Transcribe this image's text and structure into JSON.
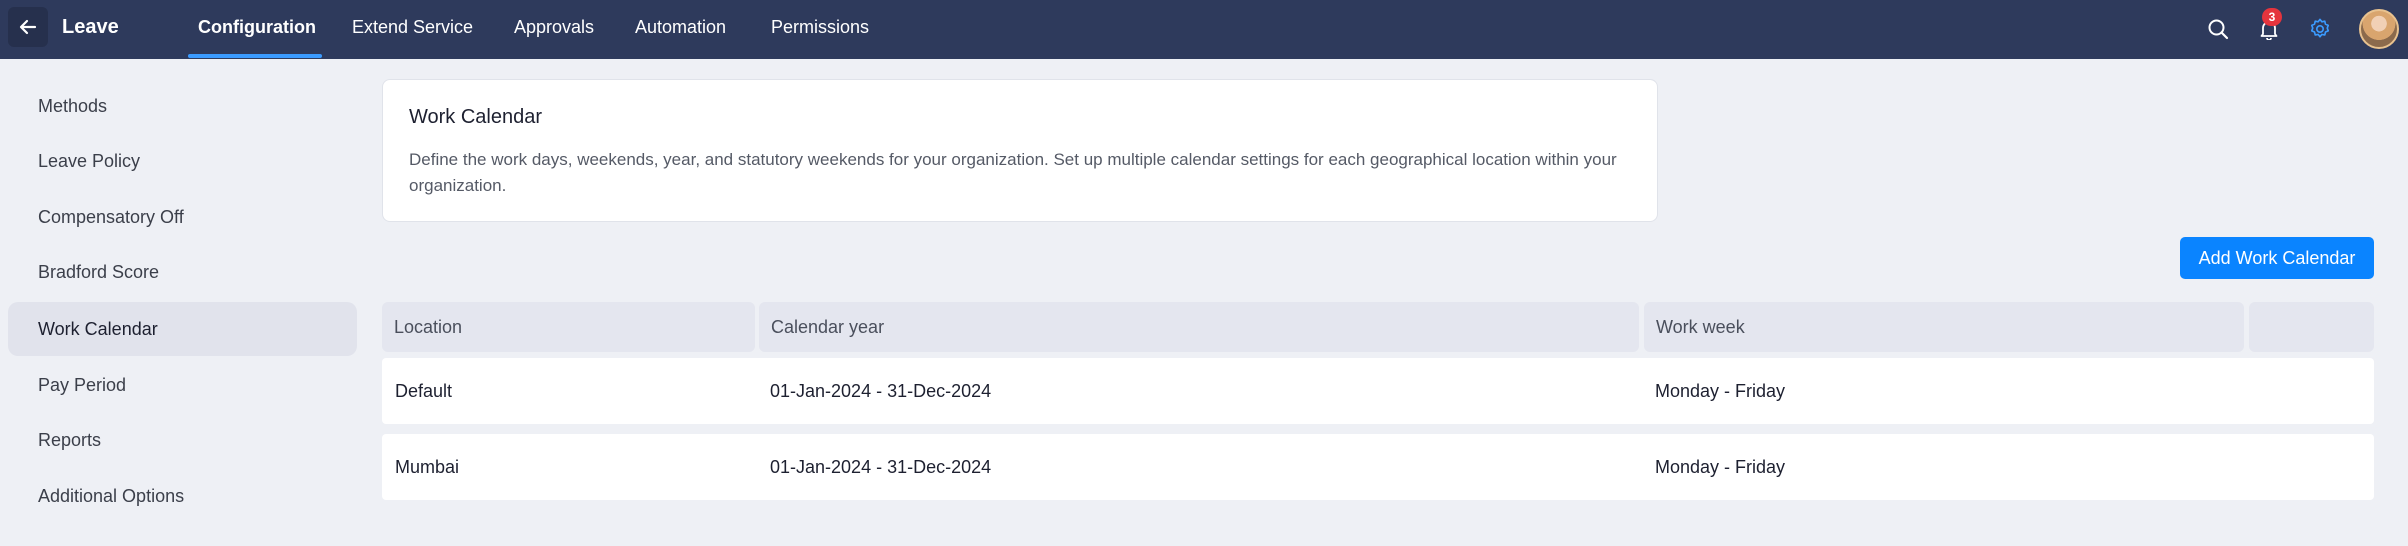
{
  "header": {
    "app_title": "Leave",
    "tabs": [
      {
        "label": "Configuration",
        "active": true
      },
      {
        "label": "Extend Service"
      },
      {
        "label": "Approvals"
      },
      {
        "label": "Automation"
      },
      {
        "label": "Permissions"
      }
    ],
    "notification_count": "3",
    "icons": [
      "back-arrow-icon",
      "search-icon",
      "bell-icon",
      "gear-icon"
    ],
    "accent_color": "#3b9bff"
  },
  "sidebar": {
    "items": [
      {
        "label": "Methods"
      },
      {
        "label": "Leave Policy"
      },
      {
        "label": "Compensatory Off"
      },
      {
        "label": "Bradford Score"
      },
      {
        "label": "Work Calendar",
        "active": true
      },
      {
        "label": "Pay Period"
      },
      {
        "label": "Reports"
      },
      {
        "label": "Additional Options"
      }
    ]
  },
  "main": {
    "card": {
      "title": "Work Calendar",
      "description": "Define the work days, weekends, year, and statutory weekends for your organization. Set up multiple calendar settings for each geographical location within your organization."
    },
    "add_button_label": "Add Work Calendar",
    "add_button_color": "#0a84ff",
    "table": {
      "headers": [
        "Location",
        "Calendar year",
        "Work week",
        ""
      ],
      "rows": [
        {
          "location": "Default",
          "calendar_year": "01-Jan-2024 - 31-Dec-2024",
          "work_week": "Monday - Friday"
        },
        {
          "location": "Mumbai",
          "calendar_year": "01-Jan-2024 - 31-Dec-2024",
          "work_week": "Monday - Friday"
        }
      ]
    }
  }
}
